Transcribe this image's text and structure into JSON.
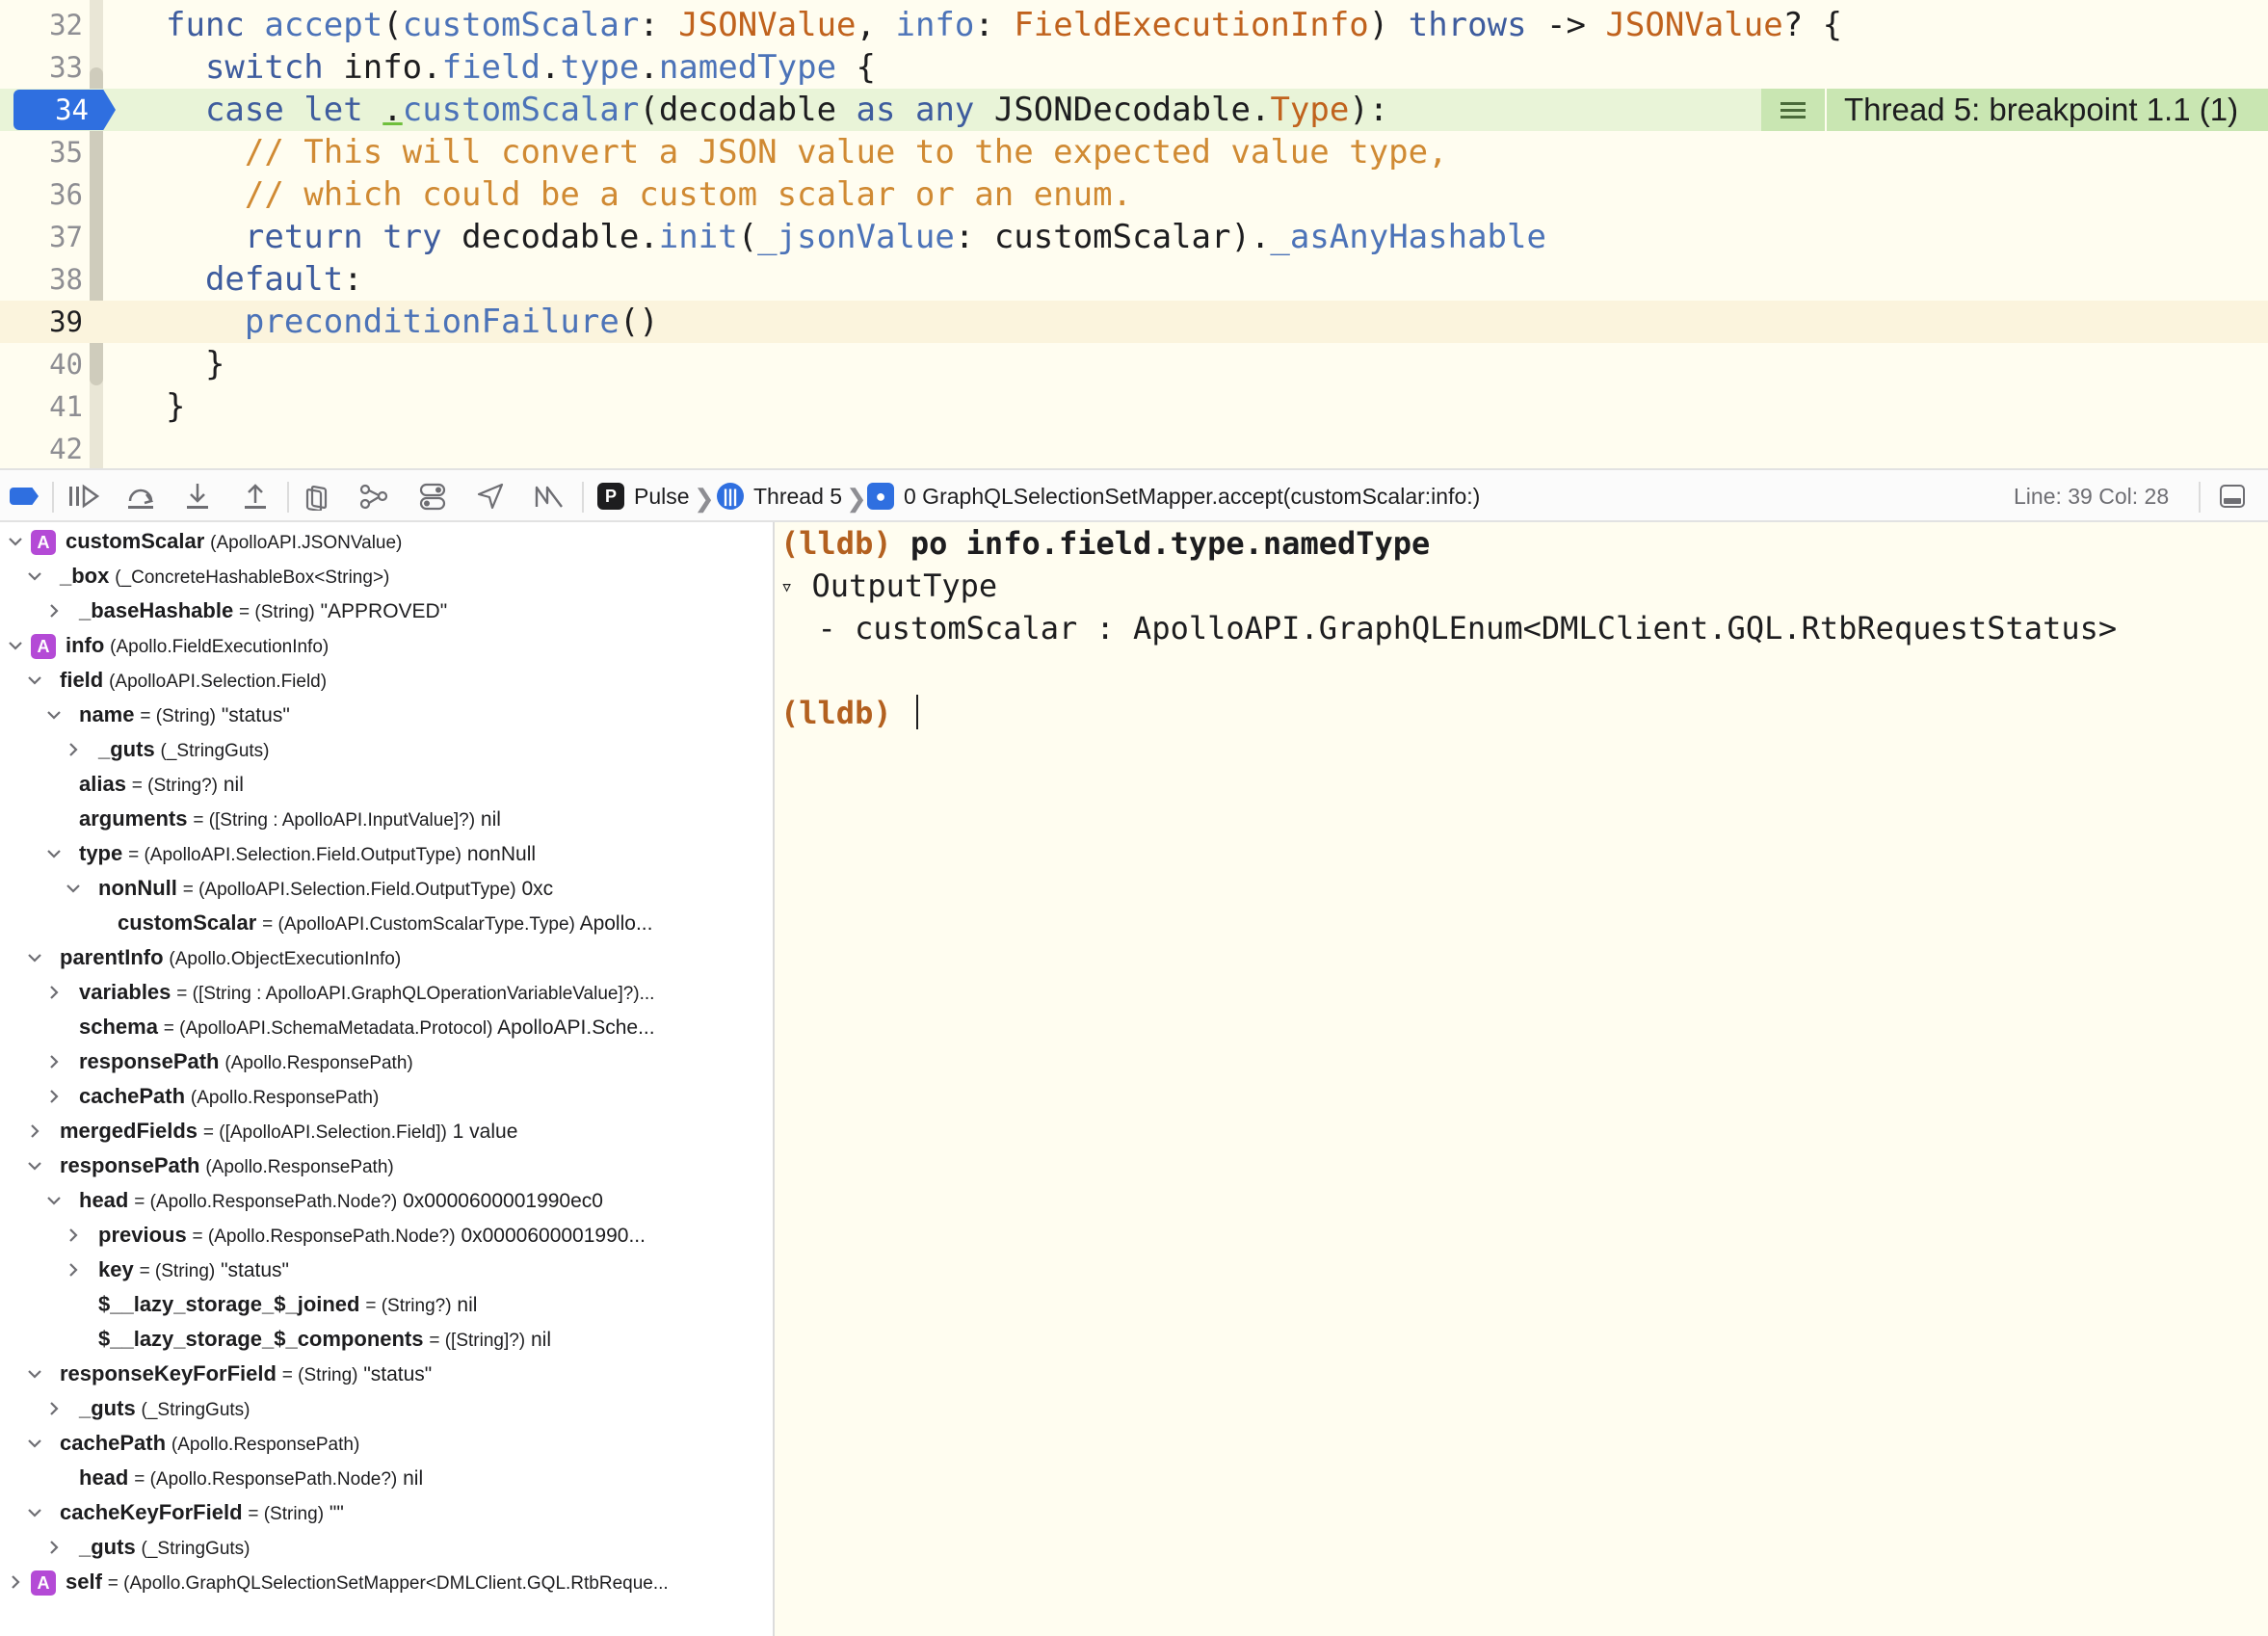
{
  "editor": {
    "lines": [
      {
        "num": "32",
        "tokens": [
          {
            "t": "func",
            "c": "k"
          },
          {
            "t": " "
          },
          {
            "t": "accept",
            "c": "f"
          },
          {
            "t": "("
          },
          {
            "t": "customScalar",
            "c": "f"
          },
          {
            "t": ": "
          },
          {
            "t": "JSONValue",
            "c": "t"
          },
          {
            "t": ", "
          },
          {
            "t": "info",
            "c": "f"
          },
          {
            "t": ": "
          },
          {
            "t": "FieldExecutionInfo",
            "c": "t"
          },
          {
            "t": ") "
          },
          {
            "t": "throws",
            "c": "k"
          },
          {
            "t": " -> "
          },
          {
            "t": "JSONValue",
            "c": "t"
          },
          {
            "t": "? {"
          }
        ]
      },
      {
        "num": "33",
        "tokens": [
          {
            "t": "  "
          },
          {
            "t": "switch",
            "c": "k"
          },
          {
            "t": " info."
          },
          {
            "t": "field",
            "c": "f"
          },
          {
            "t": "."
          },
          {
            "t": "type",
            "c": "f"
          },
          {
            "t": "."
          },
          {
            "t": "namedType",
            "c": "f"
          },
          {
            "t": " {"
          }
        ]
      },
      {
        "num": "34",
        "breakpoint": true,
        "tokens": [
          {
            "t": "  "
          },
          {
            "t": "case",
            "c": "k"
          },
          {
            "t": " "
          },
          {
            "t": "let",
            "c": "k"
          },
          {
            "t": " "
          },
          {
            "t": ".",
            "c": "u"
          },
          {
            "t": "customScalar",
            "c": "f"
          },
          {
            "t": "(decodable "
          },
          {
            "t": "as",
            "c": "k"
          },
          {
            "t": " "
          },
          {
            "t": "any",
            "c": "k"
          },
          {
            "t": " JSONDecodable."
          },
          {
            "t": "Type",
            "c": "t"
          },
          {
            "t": "):"
          }
        ]
      },
      {
        "num": "35",
        "tokens": [
          {
            "t": "    "
          },
          {
            "t": "// This will convert a JSON value to the expected value type,",
            "c": "c"
          }
        ]
      },
      {
        "num": "36",
        "tokens": [
          {
            "t": "    "
          },
          {
            "t": "// which could be a custom scalar or an enum.",
            "c": "c"
          }
        ]
      },
      {
        "num": "37",
        "tokens": [
          {
            "t": "    "
          },
          {
            "t": "return",
            "c": "k"
          },
          {
            "t": " "
          },
          {
            "t": "try",
            "c": "k"
          },
          {
            "t": " decodable."
          },
          {
            "t": "init",
            "c": "f"
          },
          {
            "t": "("
          },
          {
            "t": "_jsonValue",
            "c": "f"
          },
          {
            "t": ": customScalar)."
          },
          {
            "t": "_asAnyHashable",
            "c": "f"
          }
        ]
      },
      {
        "num": "38",
        "tokens": [
          {
            "t": "  "
          },
          {
            "t": "default",
            "c": "k"
          },
          {
            "t": ":"
          }
        ]
      },
      {
        "num": "39",
        "current": true,
        "tokens": [
          {
            "t": "    "
          },
          {
            "t": "preconditionFailure",
            "c": "f"
          },
          {
            "t": "()"
          }
        ]
      },
      {
        "num": "40",
        "tokens": [
          {
            "t": "  }"
          }
        ]
      },
      {
        "num": "41",
        "tokens": [
          {
            "t": "}"
          }
        ]
      },
      {
        "num": "42",
        "tokens": []
      }
    ],
    "breakpoint_label": "Thread 5: breakpoint 1.1 (1)"
  },
  "debug_bar": {
    "crumbs": {
      "project": "Pulse",
      "thread": "Thread 5",
      "frame": "0 GraphQLSelectionSetMapper.accept(customScalar:info:)"
    },
    "line_col": "Line: 39  Col: 28"
  },
  "variables": [
    {
      "depth": 0,
      "disc": "open",
      "badge": "A",
      "name": "customScalar",
      "type": "(ApolloAPI.JSONValue)",
      "value": ""
    },
    {
      "depth": 1,
      "disc": "open",
      "name": "_box",
      "type": "(_ConcreteHashableBox<String>)",
      "value": ""
    },
    {
      "depth": 2,
      "disc": "closed",
      "name": "_baseHashable",
      "type": "= (String)",
      "value": "\"APPROVED\""
    },
    {
      "depth": 0,
      "disc": "open",
      "badge": "A",
      "name": "info",
      "type": "(Apollo.FieldExecutionInfo)",
      "value": ""
    },
    {
      "depth": 1,
      "disc": "open",
      "name": "field",
      "type": "(ApolloAPI.Selection.Field)",
      "value": ""
    },
    {
      "depth": 2,
      "disc": "open",
      "name": "name",
      "type": "= (String)",
      "value": "\"status\""
    },
    {
      "depth": 3,
      "disc": "closed",
      "name": "_guts",
      "type": "(_StringGuts)",
      "value": ""
    },
    {
      "depth": 2,
      "disc": "none",
      "name": "alias",
      "type": "= (String?)",
      "value": "nil"
    },
    {
      "depth": 2,
      "disc": "none",
      "name": "arguments",
      "type": "= ([String : ApolloAPI.InputValue]?)",
      "value": "nil"
    },
    {
      "depth": 2,
      "disc": "open",
      "name": "type",
      "type": "= (ApolloAPI.Selection.Field.OutputType)",
      "value": "nonNull"
    },
    {
      "depth": 3,
      "disc": "open",
      "name": "nonNull",
      "type": "= (ApolloAPI.Selection.Field.OutputType)",
      "value": "0xc"
    },
    {
      "depth": 4,
      "disc": "none",
      "name": "customScalar",
      "type": "= (ApolloAPI.CustomScalarType.Type)",
      "value": "Apollo..."
    },
    {
      "depth": 1,
      "disc": "open",
      "name": "parentInfo",
      "type": "(Apollo.ObjectExecutionInfo)",
      "value": ""
    },
    {
      "depth": 2,
      "disc": "closed",
      "name": "variables",
      "type": "= ([String : ApolloAPI.GraphQLOperationVariableValue]?)...",
      "value": ""
    },
    {
      "depth": 2,
      "disc": "none",
      "name": "schema",
      "type": "= (ApolloAPI.SchemaMetadata.Protocol)",
      "value": "ApolloAPI.Sche..."
    },
    {
      "depth": 2,
      "disc": "closed",
      "name": "responsePath",
      "type": "(Apollo.ResponsePath)",
      "value": ""
    },
    {
      "depth": 2,
      "disc": "closed",
      "name": "cachePath",
      "type": "(Apollo.ResponsePath)",
      "value": ""
    },
    {
      "depth": 1,
      "disc": "closed",
      "name": "mergedFields",
      "type": "= ([ApolloAPI.Selection.Field])",
      "value": "1 value"
    },
    {
      "depth": 1,
      "disc": "open",
      "name": "responsePath",
      "type": "(Apollo.ResponsePath)",
      "value": ""
    },
    {
      "depth": 2,
      "disc": "open",
      "name": "head",
      "type": "= (Apollo.ResponsePath.Node?)",
      "value": "0x0000600001990ec0"
    },
    {
      "depth": 3,
      "disc": "closed",
      "name": "previous",
      "type": "= (Apollo.ResponsePath.Node?)",
      "value": "0x0000600001990..."
    },
    {
      "depth": 3,
      "disc": "closed",
      "name": "key",
      "type": "= (String)",
      "value": "\"status\""
    },
    {
      "depth": 3,
      "disc": "none",
      "name": "$__lazy_storage_$_joined",
      "type": "= (String?)",
      "value": "nil"
    },
    {
      "depth": 3,
      "disc": "none",
      "name": "$__lazy_storage_$_components",
      "type": "= ([String]?)",
      "value": "nil"
    },
    {
      "depth": 1,
      "disc": "open",
      "name": "responseKeyForField",
      "type": "= (String)",
      "value": "\"status\""
    },
    {
      "depth": 2,
      "disc": "closed",
      "name": "_guts",
      "type": "(_StringGuts)",
      "value": ""
    },
    {
      "depth": 1,
      "disc": "open",
      "name": "cachePath",
      "type": "(Apollo.ResponsePath)",
      "value": ""
    },
    {
      "depth": 2,
      "disc": "none",
      "name": "head",
      "type": "= (Apollo.ResponsePath.Node?)",
      "value": "nil"
    },
    {
      "depth": 1,
      "disc": "open",
      "name": "cacheKeyForField",
      "type": "= (String)",
      "value": "\"\""
    },
    {
      "depth": 2,
      "disc": "closed",
      "name": "_guts",
      "type": "(_StringGuts)",
      "value": ""
    },
    {
      "depth": 0,
      "disc": "closed",
      "badge": "A",
      "name": "self",
      "type": "= (Apollo.GraphQLSelectionSetMapper<DMLClient.GQL.RtbReque...",
      "value": ""
    }
  ],
  "console": {
    "prompt": "(lldb)",
    "command": "po info.field.type.namedType",
    "output_title": "OutputType",
    "output_item": "  - customScalar : ApolloAPI.GraphQLEnum<DMLClient.GQL.RtbRequestStatus>"
  },
  "colors": {
    "accent": "#2f6fe0",
    "breakpoint_highlight": "#c9e6b2",
    "prompt": "#b3601f",
    "variable_badge": "#b44ad6"
  }
}
